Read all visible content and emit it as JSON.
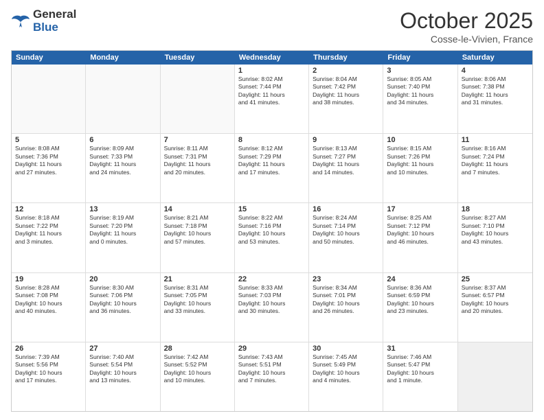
{
  "header": {
    "logo_line1": "General",
    "logo_line2": "Blue",
    "month": "October 2025",
    "location": "Cosse-le-Vivien, France"
  },
  "days_of_week": [
    "Sunday",
    "Monday",
    "Tuesday",
    "Wednesday",
    "Thursday",
    "Friday",
    "Saturday"
  ],
  "weeks": [
    [
      {
        "day": "",
        "text": "",
        "empty": true
      },
      {
        "day": "",
        "text": "",
        "empty": true
      },
      {
        "day": "",
        "text": "",
        "empty": true
      },
      {
        "day": "1",
        "text": "Sunrise: 8:02 AM\nSunset: 7:44 PM\nDaylight: 11 hours\nand 41 minutes."
      },
      {
        "day": "2",
        "text": "Sunrise: 8:04 AM\nSunset: 7:42 PM\nDaylight: 11 hours\nand 38 minutes."
      },
      {
        "day": "3",
        "text": "Sunrise: 8:05 AM\nSunset: 7:40 PM\nDaylight: 11 hours\nand 34 minutes."
      },
      {
        "day": "4",
        "text": "Sunrise: 8:06 AM\nSunset: 7:38 PM\nDaylight: 11 hours\nand 31 minutes."
      }
    ],
    [
      {
        "day": "5",
        "text": "Sunrise: 8:08 AM\nSunset: 7:36 PM\nDaylight: 11 hours\nand 27 minutes."
      },
      {
        "day": "6",
        "text": "Sunrise: 8:09 AM\nSunset: 7:33 PM\nDaylight: 11 hours\nand 24 minutes."
      },
      {
        "day": "7",
        "text": "Sunrise: 8:11 AM\nSunset: 7:31 PM\nDaylight: 11 hours\nand 20 minutes."
      },
      {
        "day": "8",
        "text": "Sunrise: 8:12 AM\nSunset: 7:29 PM\nDaylight: 11 hours\nand 17 minutes."
      },
      {
        "day": "9",
        "text": "Sunrise: 8:13 AM\nSunset: 7:27 PM\nDaylight: 11 hours\nand 14 minutes."
      },
      {
        "day": "10",
        "text": "Sunrise: 8:15 AM\nSunset: 7:26 PM\nDaylight: 11 hours\nand 10 minutes."
      },
      {
        "day": "11",
        "text": "Sunrise: 8:16 AM\nSunset: 7:24 PM\nDaylight: 11 hours\nand 7 minutes."
      }
    ],
    [
      {
        "day": "12",
        "text": "Sunrise: 8:18 AM\nSunset: 7:22 PM\nDaylight: 11 hours\nand 3 minutes."
      },
      {
        "day": "13",
        "text": "Sunrise: 8:19 AM\nSunset: 7:20 PM\nDaylight: 11 hours\nand 0 minutes."
      },
      {
        "day": "14",
        "text": "Sunrise: 8:21 AM\nSunset: 7:18 PM\nDaylight: 10 hours\nand 57 minutes."
      },
      {
        "day": "15",
        "text": "Sunrise: 8:22 AM\nSunset: 7:16 PM\nDaylight: 10 hours\nand 53 minutes."
      },
      {
        "day": "16",
        "text": "Sunrise: 8:24 AM\nSunset: 7:14 PM\nDaylight: 10 hours\nand 50 minutes."
      },
      {
        "day": "17",
        "text": "Sunrise: 8:25 AM\nSunset: 7:12 PM\nDaylight: 10 hours\nand 46 minutes."
      },
      {
        "day": "18",
        "text": "Sunrise: 8:27 AM\nSunset: 7:10 PM\nDaylight: 10 hours\nand 43 minutes."
      }
    ],
    [
      {
        "day": "19",
        "text": "Sunrise: 8:28 AM\nSunset: 7:08 PM\nDaylight: 10 hours\nand 40 minutes."
      },
      {
        "day": "20",
        "text": "Sunrise: 8:30 AM\nSunset: 7:06 PM\nDaylight: 10 hours\nand 36 minutes."
      },
      {
        "day": "21",
        "text": "Sunrise: 8:31 AM\nSunset: 7:05 PM\nDaylight: 10 hours\nand 33 minutes."
      },
      {
        "day": "22",
        "text": "Sunrise: 8:33 AM\nSunset: 7:03 PM\nDaylight: 10 hours\nand 30 minutes."
      },
      {
        "day": "23",
        "text": "Sunrise: 8:34 AM\nSunset: 7:01 PM\nDaylight: 10 hours\nand 26 minutes."
      },
      {
        "day": "24",
        "text": "Sunrise: 8:36 AM\nSunset: 6:59 PM\nDaylight: 10 hours\nand 23 minutes."
      },
      {
        "day": "25",
        "text": "Sunrise: 8:37 AM\nSunset: 6:57 PM\nDaylight: 10 hours\nand 20 minutes."
      }
    ],
    [
      {
        "day": "26",
        "text": "Sunrise: 7:39 AM\nSunset: 5:56 PM\nDaylight: 10 hours\nand 17 minutes."
      },
      {
        "day": "27",
        "text": "Sunrise: 7:40 AM\nSunset: 5:54 PM\nDaylight: 10 hours\nand 13 minutes."
      },
      {
        "day": "28",
        "text": "Sunrise: 7:42 AM\nSunset: 5:52 PM\nDaylight: 10 hours\nand 10 minutes."
      },
      {
        "day": "29",
        "text": "Sunrise: 7:43 AM\nSunset: 5:51 PM\nDaylight: 10 hours\nand 7 minutes."
      },
      {
        "day": "30",
        "text": "Sunrise: 7:45 AM\nSunset: 5:49 PM\nDaylight: 10 hours\nand 4 minutes."
      },
      {
        "day": "31",
        "text": "Sunrise: 7:46 AM\nSunset: 5:47 PM\nDaylight: 10 hours\nand 1 minute."
      },
      {
        "day": "",
        "text": "",
        "empty": true,
        "shaded": true
      }
    ]
  ]
}
